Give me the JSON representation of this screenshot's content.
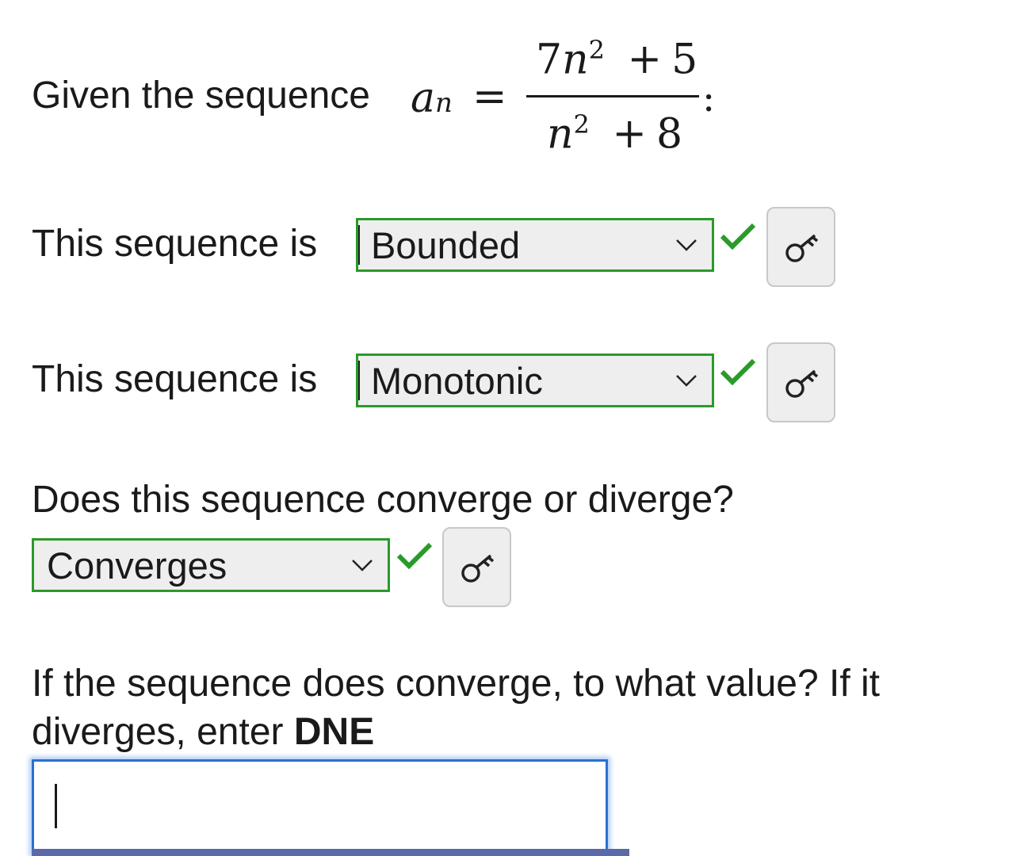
{
  "question": {
    "intro": "Given the sequence",
    "lhs_base": "a",
    "lhs_sub": "n",
    "equals": "=",
    "numerator": {
      "coef": "7",
      "var": "n",
      "exp": "2",
      "op": "+",
      "const": "5"
    },
    "denominator": {
      "var": "n",
      "exp": "2",
      "op": "+",
      "const": "8"
    },
    "colon": ":"
  },
  "q1": {
    "label": "This sequence is",
    "value": "Bounded",
    "status": "correct"
  },
  "q2": {
    "label": "This sequence is",
    "value": "Monotonic",
    "status": "correct"
  },
  "q3": {
    "prompt": "Does this sequence converge or diverge?",
    "value": "Converges",
    "status": "correct"
  },
  "q4": {
    "prompt_line1": "If the sequence does converge, to what value? If it",
    "prompt_line2": "diverges, enter",
    "prompt_bold": "DNE",
    "answer_value": ""
  },
  "colors": {
    "correct": "#2a9a2a",
    "focus": "#2c6fd1",
    "select_bg": "#eeeeee"
  },
  "icons": [
    "chevron-down-icon",
    "checkmark-icon",
    "key-icon"
  ]
}
